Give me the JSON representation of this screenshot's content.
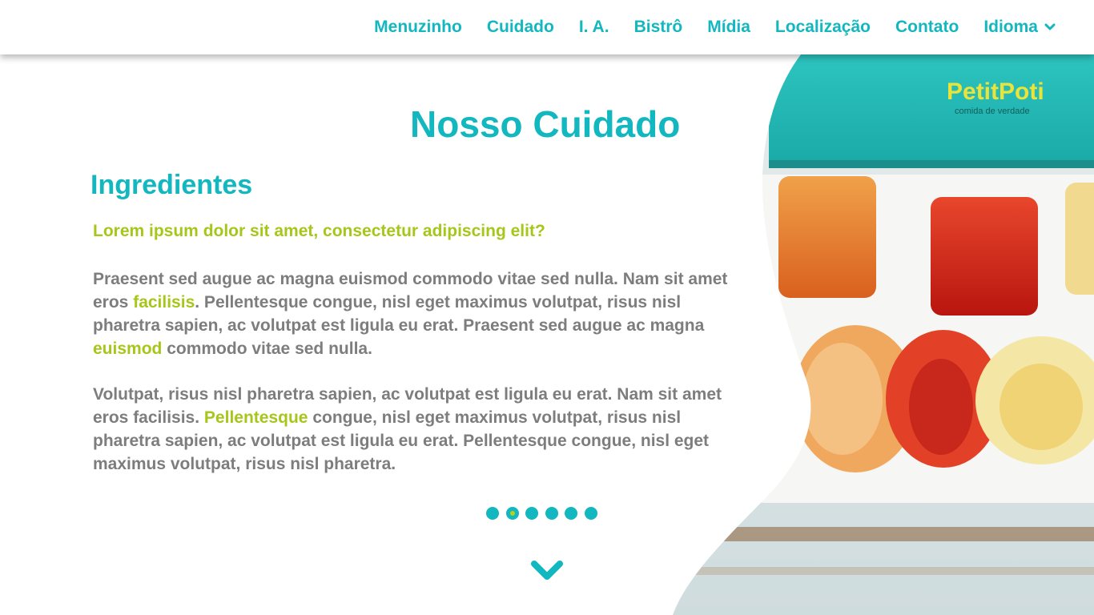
{
  "nav": {
    "items": [
      {
        "label": "Menuzinho"
      },
      {
        "label": "Cuidado"
      },
      {
        "label": "I. A."
      },
      {
        "label": "Bistrô"
      },
      {
        "label": "Mídia"
      },
      {
        "label": "Localização"
      },
      {
        "label": "Contato"
      },
      {
        "label": "Idioma",
        "icon": "chevron-down-icon"
      }
    ]
  },
  "hero": {
    "brand_name": "PetitPoti",
    "brand_tagline": "comida de verdade"
  },
  "content": {
    "page_title": "Nosso Cuidado",
    "section_title": "Ingredientes",
    "lead": "Lorem ipsum dolor sit amet, consectetur adipiscing elit?",
    "p1": {
      "a": "Praesent sed augue ac magna euismod commodo vitae sed nulla. Nam sit amet eros ",
      "b": "facilisis",
      "c": ". Pellentesque congue, nisl eget maximus volutpat, risus nisl pharetra sapien, ac volutpat est ligula eu erat. Praesent sed augue ac magna ",
      "d": "euismod",
      "e": " commodo vitae sed nulla."
    },
    "p2": {
      "a": "Volutpat, risus nisl pharetra sapien, ac volutpat est ligula eu erat. Nam sit amet eros facilisis. ",
      "b": "Pellentesque",
      "c": " congue, nisl eget maximus volutpat, risus nisl pharetra sapien, ac volutpat est ligula eu erat. Pellentesque congue, nisl eget maximus volutpat, risus nisl pharetra."
    }
  },
  "carousel": {
    "count": 6,
    "active_index": 1
  },
  "colors": {
    "teal": "#12b7bf",
    "lime": "#a6c71a",
    "body_text": "#7d7d7d"
  },
  "icons": {
    "scroll": "chevron-down-icon"
  }
}
